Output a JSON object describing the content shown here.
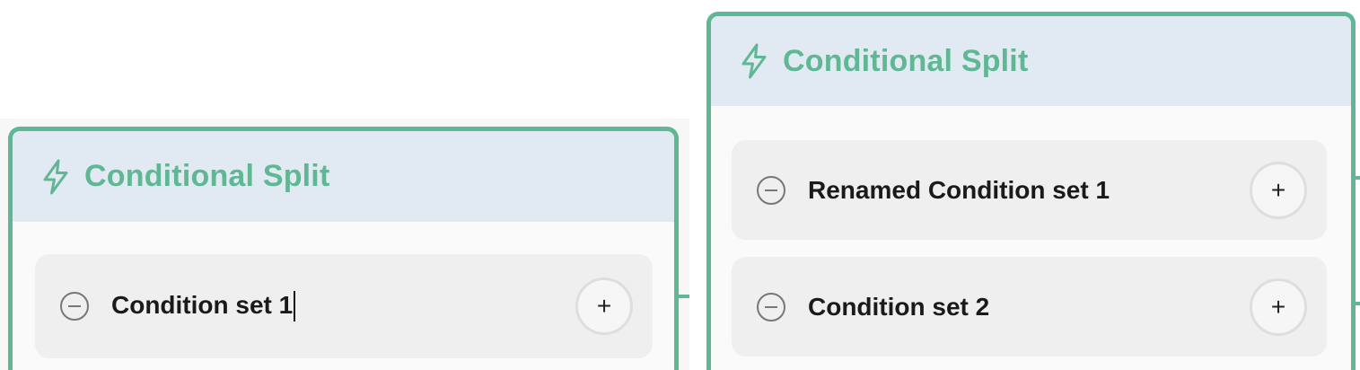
{
  "left_panel": {
    "node": {
      "title": "Conditional Split",
      "icon": "lightning-bolt-icon",
      "rows": [
        {
          "label": "Condition set 1",
          "editing": true,
          "add_button_label": "+"
        }
      ]
    }
  },
  "right_panel": {
    "node": {
      "title": "Conditional Split",
      "icon": "lightning-bolt-icon",
      "rows": [
        {
          "label": "Renamed Condition set 1",
          "add_button_label": "+"
        },
        {
          "label": "Condition set 2",
          "add_button_label": "+"
        }
      ]
    }
  },
  "colors": {
    "accent_green": "#5fb893",
    "header_bg": "#e1eaf3",
    "row_bg": "#efefef"
  }
}
